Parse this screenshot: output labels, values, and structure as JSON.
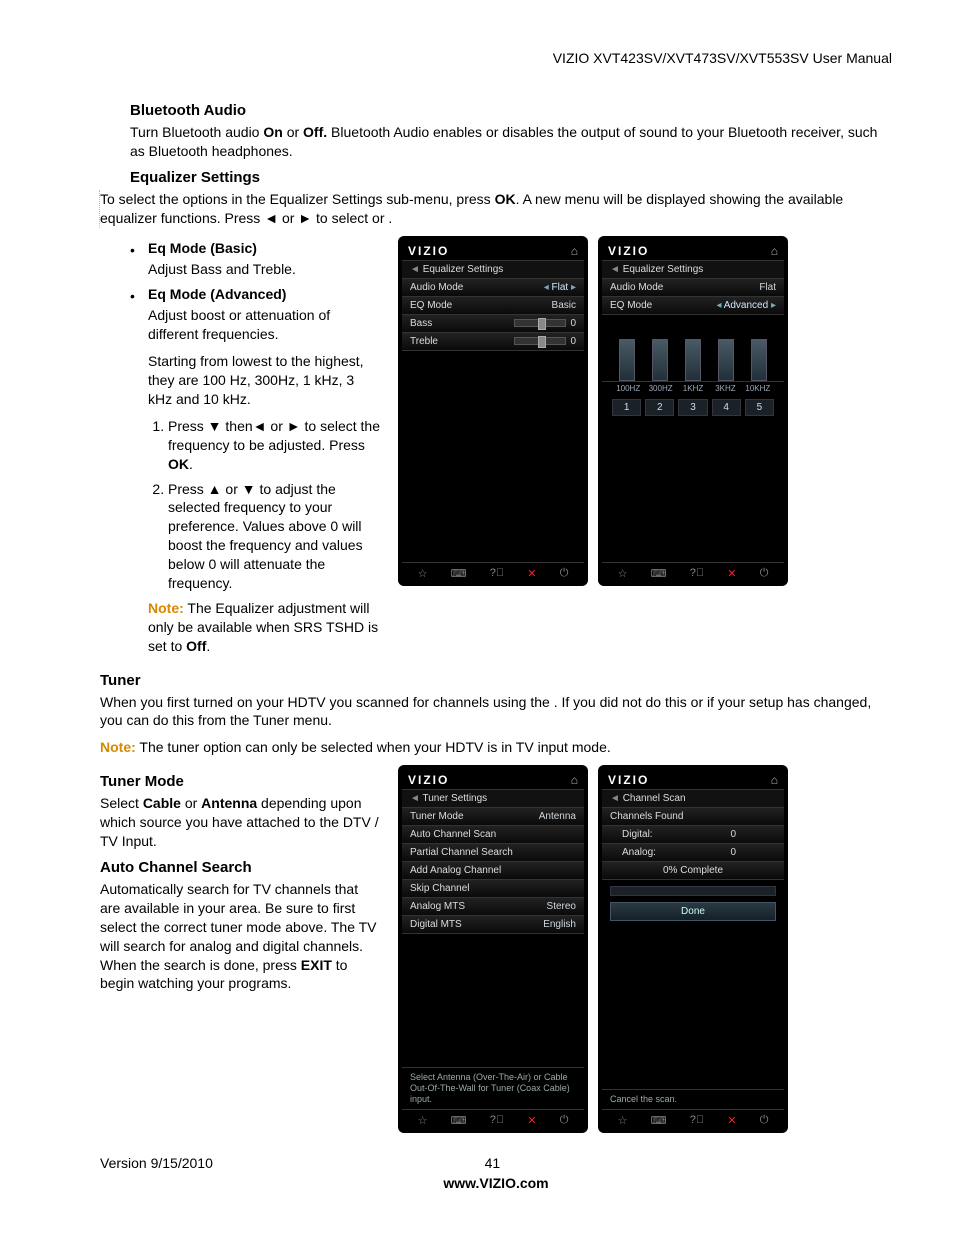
{
  "doc": {
    "header": "VIZIO XVT423SV/XVT473SV/XVT553SV User Manual",
    "version": "Version 9/15/2010",
    "page": "41",
    "site": "www.VIZIO.com"
  },
  "bt": {
    "h": "Bluetooth Audio",
    "p_a": "Turn Bluetooth audio ",
    "on": "On",
    "or": " or ",
    "off": "Off.",
    "p_b": " Bluetooth Audio enables or disables the output of sound to your Bluetooth receiver, such as Bluetooth headphones."
  },
  "eq": {
    "h": "Equalizer Settings",
    "p_a": "To select the options in the Equalizer Settings sub-menu, press ",
    "ok": "OK",
    "p_b": ". A new menu will be displayed showing the available equalizer functions. Press ◄ or ► to select            or                    .",
    "basic_h": "Eq Mode (Basic)",
    "basic_p": "Adjust Bass and Treble.",
    "adv_h": "Eq Mode (Advanced)",
    "adv_p1": "Adjust boost or attenuation of different frequencies.",
    "adv_p2": "Starting from lowest to the highest, they are 100 Hz, 300Hz, 1 kHz, 3 kHz and 10 kHz.",
    "step1_a": "Press ▼ then◄ or ► to select the frequency to be adjusted. Press ",
    "step1_b": ".",
    "step2": "Press ▲ or ▼ to adjust the selected frequency to your preference. Values above 0 will boost the frequency and values below 0 will attenuate the frequency.",
    "note_lbl": "Note:",
    "note_txt": " The Equalizer adjustment will only be available when SRS TSHD is set to ",
    "note_off": "Off",
    "note_dot": "."
  },
  "tuner": {
    "h": "Tuner",
    "p1": "When you first turned on your HDTV you scanned for channels using the                 . If you did not do this or if your setup has changed, you can do this from the Tuner menu.",
    "note_lbl": "Note:",
    "note_txt": " The tuner option can only be selected when your HDTV is in TV input mode.",
    "mode_h": "Tuner Mode",
    "mode_a": "Select ",
    "cable": "Cable",
    "or": " or ",
    "antenna": "Antenna",
    "mode_b": " depending upon which source you have attached to the DTV / TV Input.",
    "auto_h": "Auto Channel Search",
    "auto_a": "Automatically search for TV channels that are available in your area. Be sure to first select the correct tuner mode above. The TV will search for analog and digital channels. When the search is done, press ",
    "exit": "EXIT",
    "auto_b": " to begin watching your programs."
  },
  "osd": {
    "logo": "VIZIO",
    "eq_title": "Equalizer Settings",
    "audio_mode": "Audio Mode",
    "flat": "Flat",
    "eq_mode": "EQ Mode",
    "basic": "Basic",
    "advanced": "Advanced",
    "bass": "Bass",
    "bass_v": "0",
    "treble": "Treble",
    "treble_v": "0",
    "freq": [
      "100HZ",
      "300HZ",
      "1KHZ",
      "3KHZ",
      "10KHZ"
    ],
    "nums": [
      "1",
      "2",
      "3",
      "4",
      "5"
    ],
    "tuner_title": "Tuner Settings",
    "tuner_mode": "Tuner Mode",
    "tuner_mode_v": "Antenna",
    "auto_scan": "Auto Channel Scan",
    "partial": "Partial Channel Search",
    "add_analog": "Add Analog Channel",
    "skip": "Skip Channel",
    "analog_mts": "Analog MTS",
    "analog_mts_v": "Stereo",
    "digital_mts": "Digital MTS",
    "digital_mts_v": "English",
    "tuner_tip": "Select Antenna (Over-The-Air) or Cable Out-Of-The-Wall for Tuner (Coax Cable) input.",
    "scan_title": "Channel Scan",
    "ch_found": "Channels Found",
    "digital": "Digital:",
    "digital_v": "0",
    "analog": "Analog:",
    "analog_v": "0",
    "complete": "0% Complete",
    "done": "Done",
    "cancel": "Cancel the scan."
  }
}
